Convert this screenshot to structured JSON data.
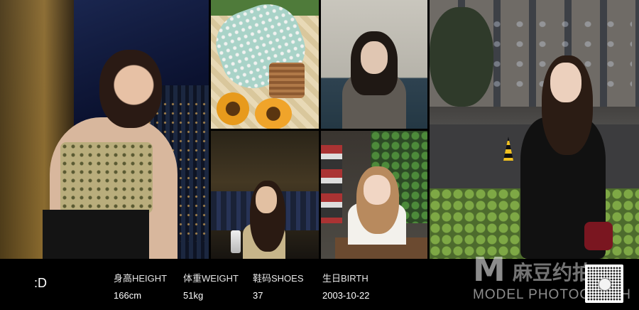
{
  "photos": [
    {
      "id": "night-window-portrait"
    },
    {
      "id": "picnic-sunflowers"
    },
    {
      "id": "classroom-portrait"
    },
    {
      "id": "lounge-night-portrait"
    },
    {
      "id": "cafe-portrait"
    },
    {
      "id": "street-night-portrait"
    }
  ],
  "profile": {
    "handle": ":D",
    "stats": [
      {
        "label": "身高HEIGHT",
        "value": "166cm"
      },
      {
        "label": "体重WEIGHT",
        "value": "51kg"
      },
      {
        "label": "鞋码SHOES",
        "value": "37"
      },
      {
        "label": "生日BIRTH",
        "value": "2003-10-22"
      }
    ]
  },
  "watermark": {
    "logo_letter": "M",
    "name_cn": "麻豆约拍",
    "name_en": "MODEL PHOTOGRAPH"
  },
  "qr": {
    "icon": "qr-code-icon"
  }
}
